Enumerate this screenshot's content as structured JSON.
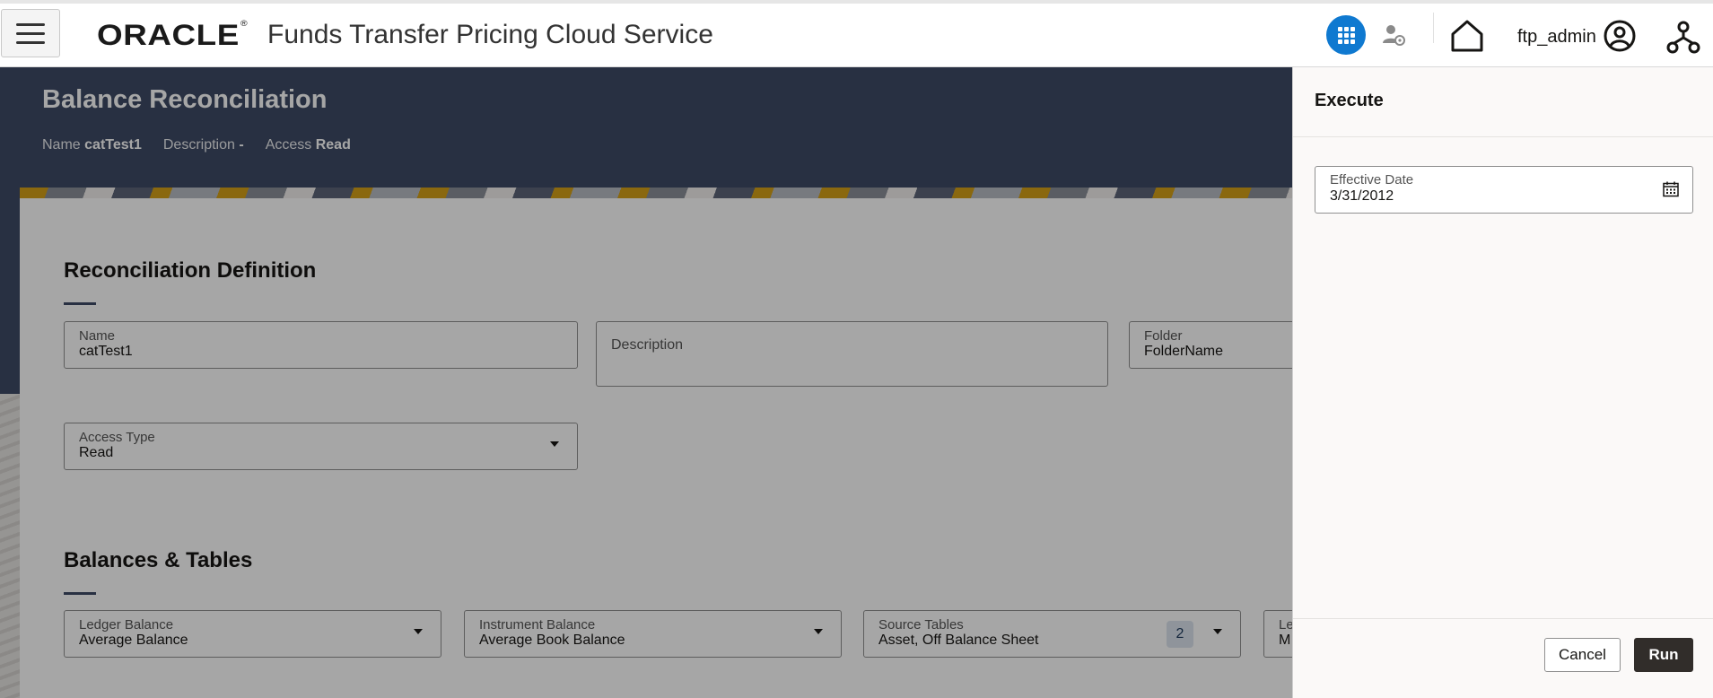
{
  "header": {
    "logo": "ORACLE",
    "logo_mark": "®",
    "app_title": "Funds Transfer Pricing Cloud Service",
    "username": "ftp_admin",
    "icons": [
      "menu-icon",
      "apps-grid-icon",
      "user-settings-icon",
      "home-icon",
      "user-avatar-icon",
      "org-hierarchy-icon"
    ],
    "accent_color": "#0f79d0"
  },
  "page": {
    "title": "Balance Reconciliation",
    "meta": [
      {
        "key": "Name",
        "value": "catTest1"
      },
      {
        "key": "Description",
        "value": "-"
      },
      {
        "key": "Access",
        "value": "Read"
      }
    ],
    "banner_color": "#3e4b66"
  },
  "definition": {
    "section_title": "Reconciliation Definition",
    "name": {
      "label": "Name",
      "value": "catTest1"
    },
    "description": {
      "label": "Description",
      "value": ""
    },
    "folder": {
      "label": "Folder",
      "value": "FolderName"
    },
    "access_type": {
      "label": "Access Type",
      "value": "Read"
    }
  },
  "balances": {
    "section_title": "Balances & Tables",
    "ledger_balance": {
      "label": "Ledger Balance",
      "value": "Average Balance"
    },
    "instrument_balance": {
      "label": "Instrument Balance",
      "value": "Average Book Balance"
    },
    "source_tables": {
      "label": "Source Tables",
      "value": "Asset, Off Balance Sheet",
      "count": "2"
    },
    "ledger_partial": {
      "label": "Le",
      "value": "M"
    }
  },
  "drawer": {
    "title": "Execute",
    "effective_date": {
      "label": "Effective Date",
      "value": "3/31/2012"
    },
    "cancel_label": "Cancel",
    "run_label": "Run",
    "run_color": "#312d2a"
  }
}
